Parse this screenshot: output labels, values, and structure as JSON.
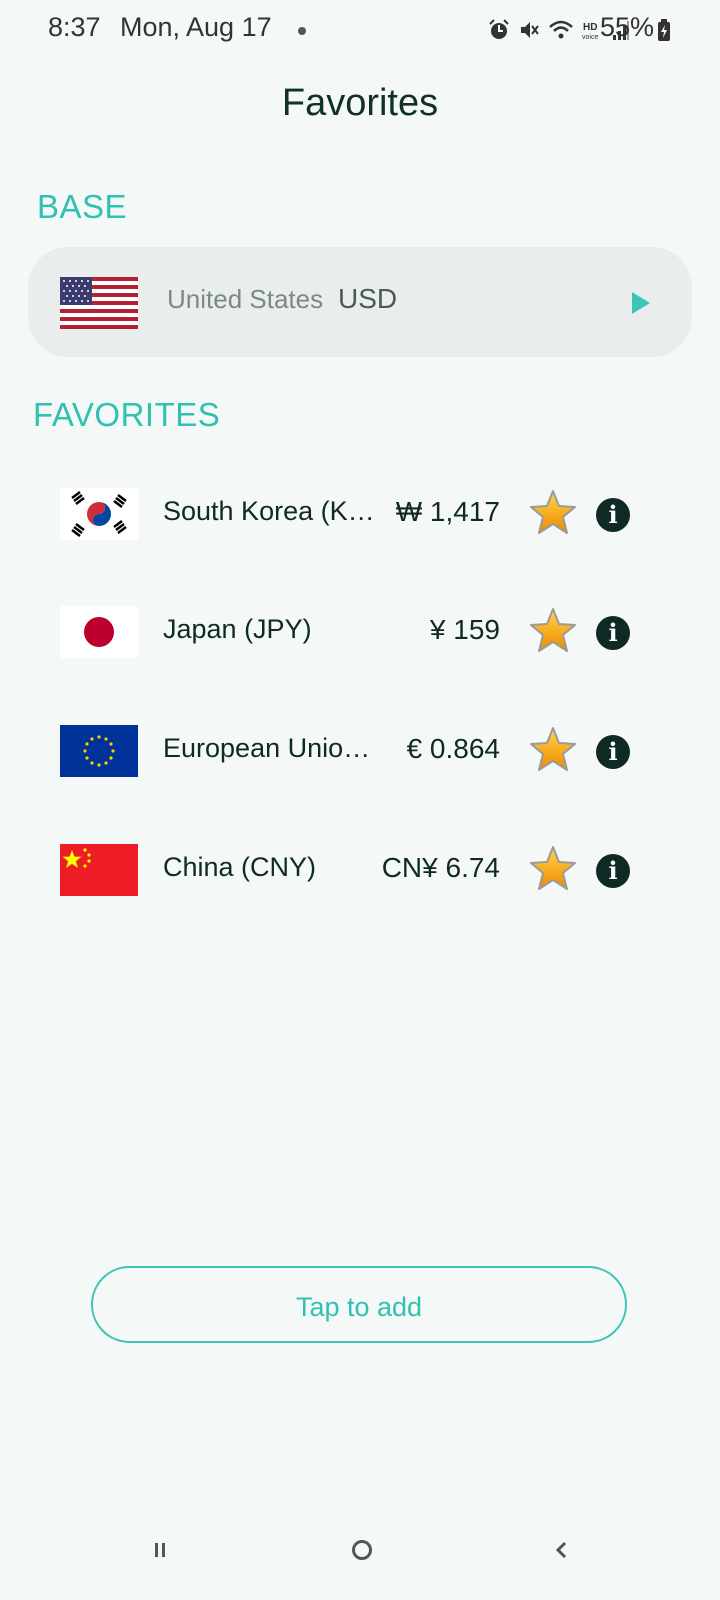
{
  "status_bar": {
    "time": "8:37",
    "date": "Mon, Aug 17",
    "battery": "55%"
  },
  "page": {
    "title": "Favorites"
  },
  "base": {
    "heading": "BASE",
    "country": "United States",
    "code": "USD",
    "flag": "us-flag"
  },
  "favorites": {
    "heading": "FAVORITES",
    "items": [
      {
        "name": "South Korea (KRW)",
        "rate": "₩ 1,417",
        "flag": "south-korea-flag"
      },
      {
        "name": "Japan (JPY)",
        "rate": "¥ 159",
        "flag": "japan-flag"
      },
      {
        "name": "European Union (EUR)",
        "rate": "€ 0.864",
        "flag": "eu-flag"
      },
      {
        "name": "China (CNY)",
        "rate": "CN¥ 6.74",
        "flag": "china-flag"
      }
    ]
  },
  "add_button": {
    "label": "Tap to add"
  },
  "colors": {
    "accent": "#31c1b3",
    "background": "#f4f8f7",
    "base_card": "#e9eeec",
    "text_dark": "#0f2a24"
  }
}
